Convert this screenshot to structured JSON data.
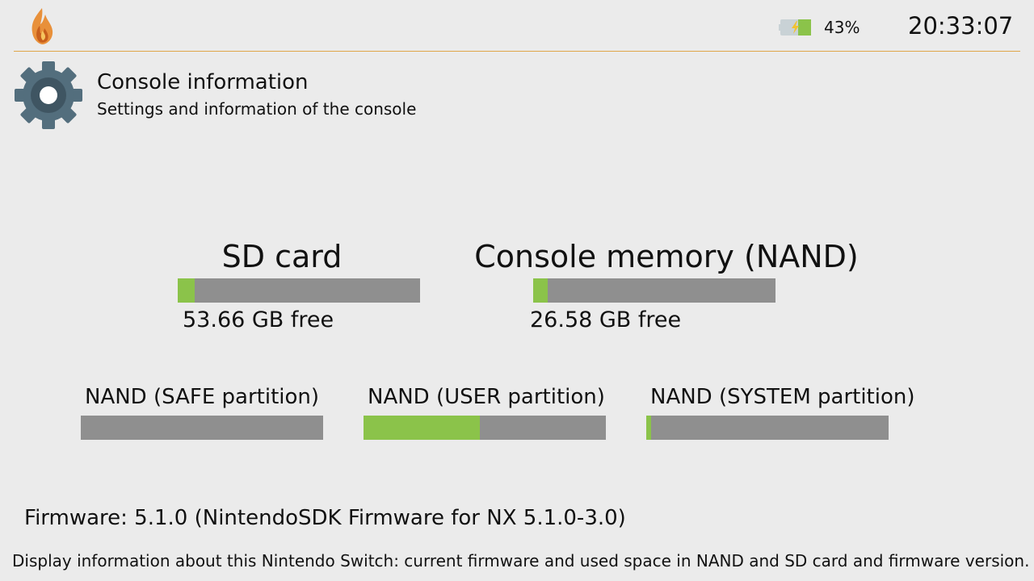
{
  "header": {
    "logo_icon": "flame-logo-icon",
    "battery_icon": "battery-charging-icon",
    "battery_percent": "43%",
    "battery_level": 0.43,
    "clock": "20:33:07",
    "separator_color": "#e0a64a"
  },
  "page": {
    "icon": "gear-icon",
    "title": "Console information",
    "subtitle": "Settings and information of the console"
  },
  "storage": {
    "sd": {
      "title": "SD card",
      "free_text": "53.66 GB free",
      "used_fraction": 0.07
    },
    "nand": {
      "title": "Console memory (NAND)",
      "free_text": "26.58 GB free",
      "used_fraction": 0.06
    }
  },
  "partitions": {
    "safe": {
      "title": "NAND (SAFE partition)",
      "used_fraction": 0.0
    },
    "user": {
      "title": "NAND (USER partition)",
      "used_fraction": 0.48
    },
    "system": {
      "title": "NAND (SYSTEM partition)",
      "used_fraction": 0.02
    }
  },
  "firmware": "Firmware: 5.1.0 (NintendoSDK Firmware for NX 5.1.0-3.0)",
  "footer": "Display information about this Nintendo Switch: current firmware and used space in NAND and SD card and firmware version.",
  "colors": {
    "background": "#ebebeb",
    "bar_track": "#8f8f8f",
    "bar_fill": "#8bc34a",
    "gear": "#536e7d"
  }
}
